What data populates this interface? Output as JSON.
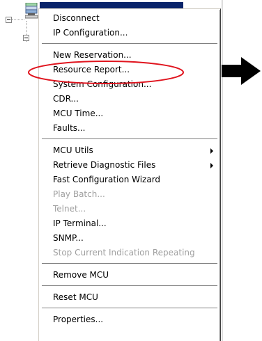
{
  "tree": {
    "root_expander": "collapse-box",
    "child_expander": "collapse-box",
    "node_icon": "mcu-icon",
    "selected_color": "#0a246a"
  },
  "menu": {
    "groups": [
      {
        "items": [
          {
            "label": "Disconnect",
            "disabled": false,
            "submenu": false
          },
          {
            "label": "IP Configuration...",
            "disabled": false,
            "submenu": false
          }
        ]
      },
      {
        "items": [
          {
            "label": "New Reservation...",
            "disabled": false,
            "submenu": false
          },
          {
            "label": "Resource Report...",
            "disabled": false,
            "submenu": false
          },
          {
            "label": "System Configuration...",
            "disabled": false,
            "submenu": false
          },
          {
            "label": "CDR...",
            "disabled": false,
            "submenu": false
          },
          {
            "label": "MCU Time...",
            "disabled": false,
            "submenu": false
          },
          {
            "label": "Faults...",
            "disabled": false,
            "submenu": false
          }
        ]
      },
      {
        "items": [
          {
            "label": "MCU Utils",
            "disabled": false,
            "submenu": true
          },
          {
            "label": "Retrieve Diagnostic Files",
            "disabled": false,
            "submenu": true
          },
          {
            "label": "Fast Configuration Wizard",
            "disabled": false,
            "submenu": false
          },
          {
            "label": "Play Batch...",
            "disabled": true,
            "submenu": false
          },
          {
            "label": "Telnet...",
            "disabled": true,
            "submenu": false
          },
          {
            "label": "IP Terminal...",
            "disabled": false,
            "submenu": false
          },
          {
            "label": "SNMP...",
            "disabled": false,
            "submenu": false
          },
          {
            "label": "Stop Current Indication Repeating",
            "disabled": true,
            "submenu": false
          }
        ]
      },
      {
        "items": [
          {
            "label": "Remove MCU",
            "disabled": false,
            "submenu": false
          }
        ]
      },
      {
        "items": [
          {
            "label": "Reset MCU",
            "disabled": false,
            "submenu": false
          }
        ]
      },
      {
        "items": [
          {
            "label": "Properties...",
            "disabled": false,
            "submenu": false
          }
        ]
      }
    ]
  },
  "annotation": {
    "highlighted_item": "Resource Report...",
    "ellipse_color": "#e0141e",
    "arrow_color": "#000000"
  }
}
